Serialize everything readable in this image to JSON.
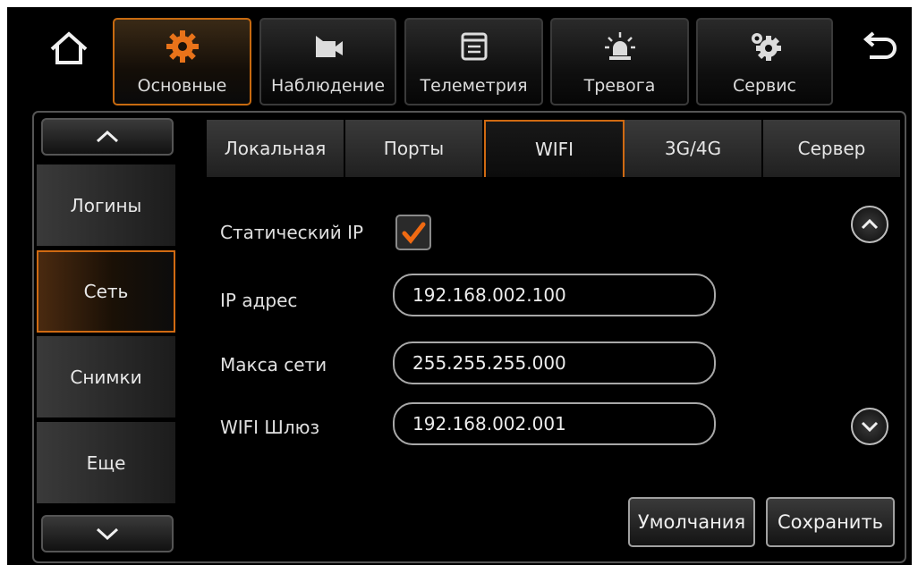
{
  "toolbar": {
    "items": [
      {
        "label": "Основные",
        "icon": "gear-icon"
      },
      {
        "label": "Наблюдение",
        "icon": "video-camera-icon"
      },
      {
        "label": "Телеметрия",
        "icon": "telemetry-window-icon"
      },
      {
        "label": "Тревога",
        "icon": "alarm-siren-icon"
      },
      {
        "label": "Сервис",
        "icon": "service-gears-icon"
      }
    ],
    "home_icon": "home-icon",
    "back_icon": "back-icon"
  },
  "sidebar": {
    "items": [
      {
        "label": "Логины"
      },
      {
        "label": "Сеть"
      },
      {
        "label": "Снимки"
      },
      {
        "label": "Еще"
      }
    ]
  },
  "tabs": [
    {
      "label": "Локальная"
    },
    {
      "label": "Порты"
    },
    {
      "label": "WIFI"
    },
    {
      "label": "3G/4G"
    },
    {
      "label": "Сервер"
    }
  ],
  "form": {
    "static_ip_label": "Статический IP",
    "static_ip_checked": true,
    "ip_label": "IP адрес",
    "ip_value": "192.168.002.100",
    "mask_label": "Макса сети",
    "mask_value": "255.255.255.000",
    "gateway_label": "WIFI Шлюз",
    "gateway_value": "192.168.002.001"
  },
  "buttons": {
    "default_label": "Умолчания",
    "save_label": "Сохранить"
  },
  "colors": {
    "accent": "#d06a12",
    "background": "#000000"
  }
}
